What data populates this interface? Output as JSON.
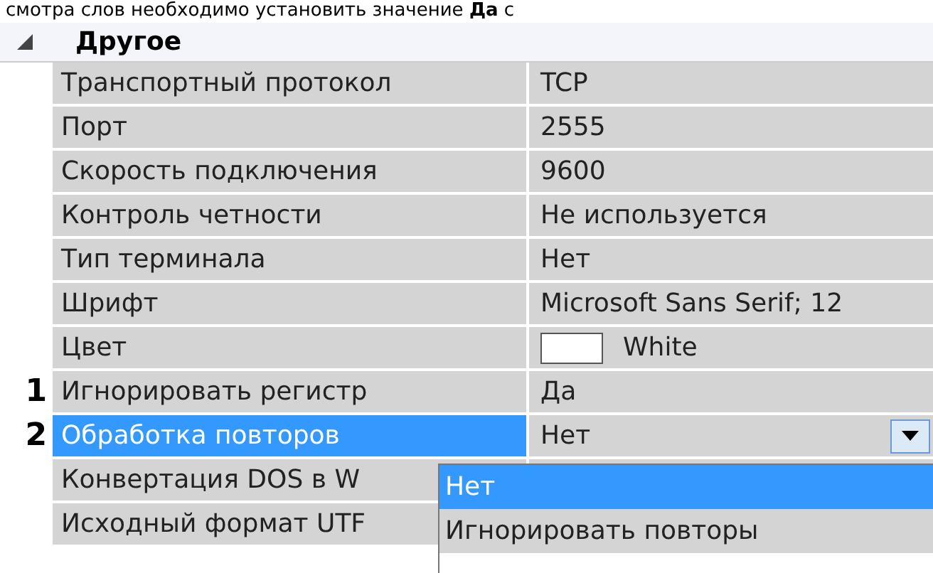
{
  "intro_text": "смотра слов необходимо установить значение **Да** с",
  "group": {
    "title": "Другое",
    "expanded": true
  },
  "rows": [
    {
      "kind": "text",
      "name": "Транспортный протокол",
      "value": "TCP",
      "selected": false
    },
    {
      "kind": "text",
      "name": "Порт",
      "value": "2555",
      "selected": false
    },
    {
      "kind": "text",
      "name": "Скорость подключения",
      "value": "9600",
      "selected": false
    },
    {
      "kind": "text",
      "name": "Контроль четности",
      "value": "Не используется",
      "selected": false
    },
    {
      "kind": "text",
      "name": "Тип терминала",
      "value": "Нет",
      "selected": false
    },
    {
      "kind": "text",
      "name": "Шрифт",
      "value": "Microsoft Sans Serif; 12",
      "selected": false
    },
    {
      "kind": "color",
      "name": "Цвет",
      "value": "White",
      "color": "#ffffff",
      "selected": false
    },
    {
      "kind": "text",
      "marker": "1",
      "name": "Игнорировать регистр",
      "value": "Да",
      "selected": false
    },
    {
      "kind": "dropdown",
      "marker": "2",
      "name": "Обработка повторов",
      "value": "Нет",
      "selected": true
    },
    {
      "kind": "text",
      "name": "Конвертация DOS в W",
      "selected": false
    },
    {
      "kind": "text",
      "name": "Исходный формат UTF",
      "selected": false
    }
  ],
  "dropdown": {
    "options": [
      {
        "label": "Нет",
        "selected": true
      },
      {
        "label": "Игнорировать повторы",
        "selected": false
      }
    ]
  }
}
